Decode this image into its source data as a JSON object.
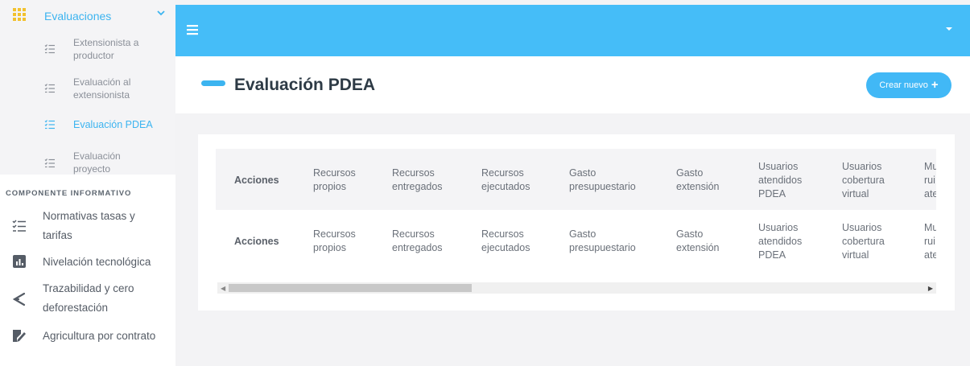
{
  "sidebar": {
    "group": {
      "label": "Evaluaciones"
    },
    "subitems": [
      {
        "label_line1": "Extensionista a",
        "label_line2": "productor"
      },
      {
        "label_line1": "Evaluación al",
        "label_line2": "extensionista"
      },
      {
        "label_line1": "Evaluación PDEA",
        "label_line2": ""
      },
      {
        "label_line1": "Evaluación",
        "label_line2": "proyecto"
      }
    ],
    "section_title": "COMPONENTE INFORMATIVO",
    "items": [
      {
        "label_line1": "Normativas tasas y",
        "label_line2": "tarifas",
        "icon": "list-check-icon"
      },
      {
        "label_line1": "Nivelación tecnológica",
        "label_line2": "",
        "icon": "bar-chart-icon"
      },
      {
        "label_line1": "Trazabilidad y cero",
        "label_line2": "deforestación",
        "icon": "share-icon"
      },
      {
        "label_line1": "Agricultura por contrato",
        "label_line2": "",
        "icon": "document-sign-icon"
      }
    ]
  },
  "header": {
    "title": "Evaluación PDEA",
    "create_label": "Crear nuevo"
  },
  "table": {
    "columns": [
      [
        "Acciones",
        ""
      ],
      [
        "Recursos",
        "propios"
      ],
      [
        "Recursos",
        "entregados"
      ],
      [
        "Recursos",
        "ejecutados"
      ],
      [
        "Gasto",
        "presupuestario"
      ],
      [
        "Gasto",
        "extensión"
      ],
      [
        "Usuarios",
        "atendidos",
        "PDEA"
      ],
      [
        "Usuarios",
        "cobertura",
        "virtual"
      ],
      [
        "Mu",
        "rui",
        "ate"
      ]
    ],
    "footer_columns": [
      [
        "Acciones",
        ""
      ],
      [
        "Recursos",
        "propios"
      ],
      [
        "Recursos",
        "entregados"
      ],
      [
        "Recursos",
        "ejecutados"
      ],
      [
        "Gasto",
        "presupuestario"
      ],
      [
        "Gasto",
        "extensión"
      ],
      [
        "Usuarios",
        "atendidos",
        "PDEA"
      ],
      [
        "Usuarios",
        "cobertura",
        "virtual"
      ],
      [
        "Mu",
        "rui",
        "ate"
      ]
    ]
  },
  "colors": {
    "accent": "#45bdf8",
    "active": "#3cb4f0"
  }
}
